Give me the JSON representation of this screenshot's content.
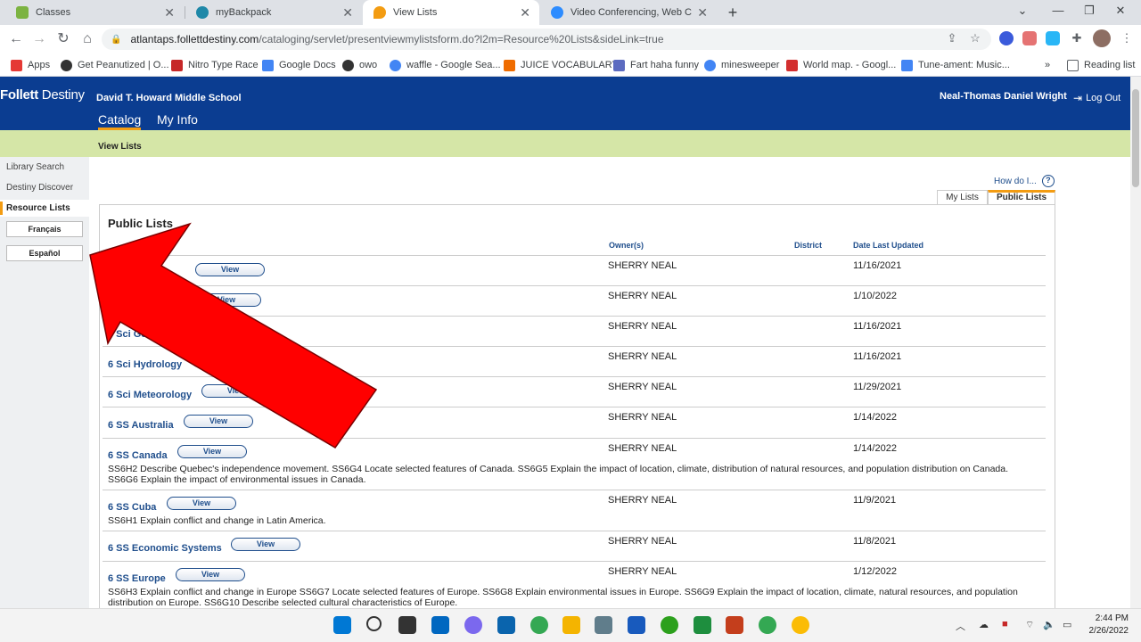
{
  "browser": {
    "tabs": [
      {
        "title": "Classes",
        "color": "#7cb342"
      },
      {
        "title": "myBackpack",
        "color": "#1e88a8"
      },
      {
        "title": "View Lists",
        "color": "#f39c12"
      },
      {
        "title": "Video Conferencing, Web Confer",
        "color": "#2d8cff"
      }
    ],
    "url_domain": "atlantaps.follettdestiny.com",
    "url_path": "/cataloging/servlet/presentviewmylistsform.do?l2m=Resource%20Lists&sideLink=true",
    "bookmarks": [
      {
        "label": "Apps",
        "color": "#e53935"
      },
      {
        "label": "Get Peanutized | O...",
        "color": "#333333"
      },
      {
        "label": "Nitro Type Race",
        "color": "#c62828"
      },
      {
        "label": "Google Docs",
        "color": "#4285f4"
      },
      {
        "label": "owo",
        "color": "#333333"
      },
      {
        "label": "waffle - Google Sea...",
        "color": "#4285f4"
      },
      {
        "label": "JUICE VOCABULARY",
        "color": "#ef6c00"
      },
      {
        "label": "Fart haha funny",
        "color": "#5c6bc0"
      },
      {
        "label": "minesweeper",
        "color": "#4285f4"
      },
      {
        "label": "World map. - Googl...",
        "color": "#d32f2f"
      },
      {
        "label": "Tune-ament: Music...",
        "color": "#4285f4"
      }
    ],
    "reading_list": "Reading list"
  },
  "app": {
    "logo_brand": "Follett",
    "logo_product": "Destiny",
    "school": "David T. Howard Middle School",
    "nav": [
      "Catalog",
      "My Info"
    ],
    "user": "Neal-Thomas Daniel Wright",
    "logout": "Log Out",
    "breadcrumb": "View Lists"
  },
  "sidebar": {
    "items": [
      "Library Search",
      "Destiny Discover",
      "Resource Lists"
    ],
    "languages": [
      "Français",
      "Español"
    ]
  },
  "content": {
    "how_do_i": "How do I...",
    "subtabs": [
      "My Lists",
      "Public Lists"
    ],
    "title": "Public Lists",
    "columns": {
      "owners": "Owner(s)",
      "district": "District",
      "date": "Date Last Updated"
    },
    "view_label": "View",
    "rows": [
      {
        "name": "",
        "owner": "SHERRY NEAL",
        "date": "11/16/2021",
        "desc": ""
      },
      {
        "name": "",
        "owner": "SHERRY NEAL",
        "date": "1/10/2022",
        "desc": ""
      },
      {
        "name": "6 Sci Geology",
        "owner": "SHERRY NEAL",
        "date": "11/16/2021",
        "desc": ""
      },
      {
        "name": "6 Sci Hydrology",
        "owner": "SHERRY NEAL",
        "date": "11/16/2021",
        "desc": ""
      },
      {
        "name": "6 Sci Meteorology",
        "owner": "SHERRY NEAL",
        "date": "11/29/2021",
        "desc": ""
      },
      {
        "name": "6 SS Australia",
        "owner": "SHERRY NEAL",
        "date": "1/14/2022",
        "desc": ""
      },
      {
        "name": "6 SS Canada",
        "owner": "SHERRY NEAL",
        "date": "1/14/2022",
        "desc": "SS6H2 Describe Quebec's independence movement. SS6G4 Locate selected features of Canada. SS6G5 Explain the impact of location, climate, distribution of natural resources, and population distribution on Canada. SS6G6 Explain the impact of environmental issues in Canada."
      },
      {
        "name": "6 SS Cuba",
        "owner": "SHERRY NEAL",
        "date": "11/9/2021",
        "desc": "SS6H1 Explain conflict and change in Latin America."
      },
      {
        "name": "6 SS Economic Systems",
        "owner": "SHERRY NEAL",
        "date": "11/8/2021",
        "desc": ""
      },
      {
        "name": "6 SS Europe",
        "owner": "SHERRY NEAL",
        "date": "1/12/2022",
        "desc": "SS6H3 Explain conflict and change in Europe SS6G7 Locate selected features of Europe. SS6G8 Explain environmental issues in Europe. SS6G9 Explain the impact of location, climate, natural resources, and population distribution on Europe. SS6G10 Describe selected cultural characteristics of Europe."
      }
    ]
  },
  "taskbar": {
    "time": "2:44 PM",
    "date": "2/26/2022"
  },
  "colors": {
    "header_bg": "#0b3d91",
    "subnav_bg": "#d5e6a7",
    "accent": "#f39c12",
    "link": "#1f4e8c",
    "arrow": "#ff0000"
  }
}
